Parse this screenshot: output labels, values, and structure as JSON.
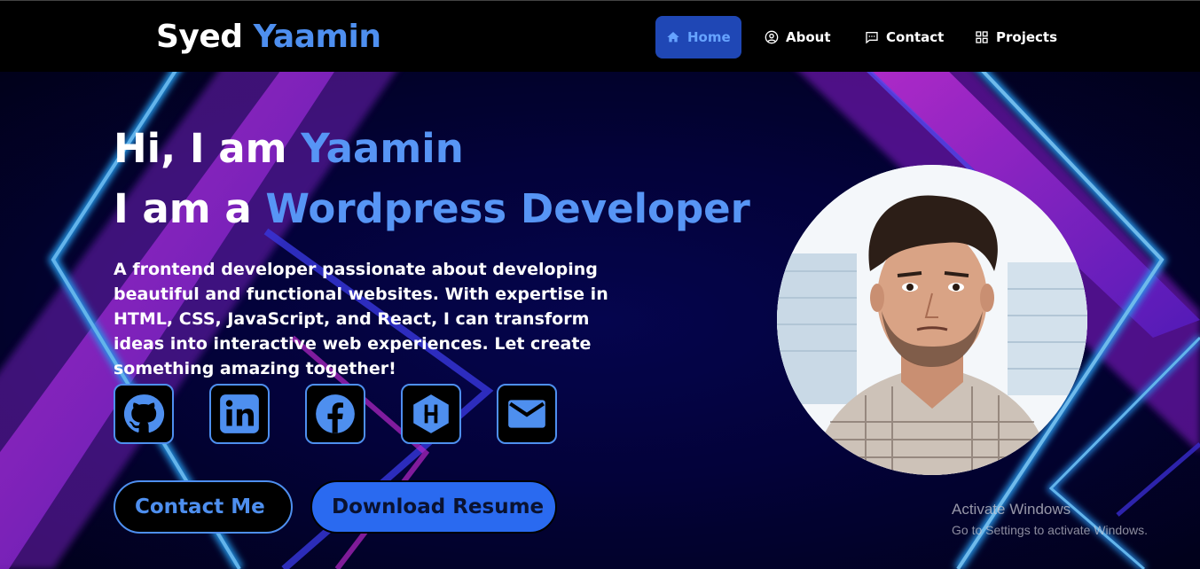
{
  "brand": {
    "first": "Syed",
    "last": "Yaamin"
  },
  "nav": {
    "items": [
      {
        "label": "Home",
        "icon": "home-icon",
        "active": true
      },
      {
        "label": "About",
        "icon": "user-circle-icon",
        "active": false
      },
      {
        "label": "Contact",
        "icon": "chat-icon",
        "active": false
      },
      {
        "label": "Projects",
        "icon": "grid-icon",
        "active": false
      }
    ]
  },
  "hero": {
    "line1_prefix": "Hi, I am",
    "line1_name": "Yaamin",
    "line2_prefix": "I am a",
    "line2_role": "Wordpress Developer",
    "description": "A frontend developer passionate about developing beautiful and functional websites. With expertise in HTML, CSS, JavaScript, and React, I can transform ideas into interactive web experiences. Let create something amazing together!"
  },
  "socials": [
    {
      "name": "github",
      "icon": "github-icon"
    },
    {
      "name": "linkedin",
      "icon": "linkedin-icon"
    },
    {
      "name": "facebook",
      "icon": "facebook-icon"
    },
    {
      "name": "hashnode",
      "icon": "hashnode-icon"
    },
    {
      "name": "email",
      "icon": "mail-icon"
    }
  ],
  "buttons": {
    "contact": "Contact Me",
    "resume": "Download Resume"
  },
  "watermark": {
    "title": "Activate Windows",
    "subtitle": "Go to Settings to activate Windows."
  },
  "colors": {
    "accent": "#4e8fef",
    "nav_active_bg": "#1f47b5",
    "hero_bg": "#04033f",
    "neon_pink": "#c42bd8",
    "neon_cyan": "#1f9fff"
  }
}
